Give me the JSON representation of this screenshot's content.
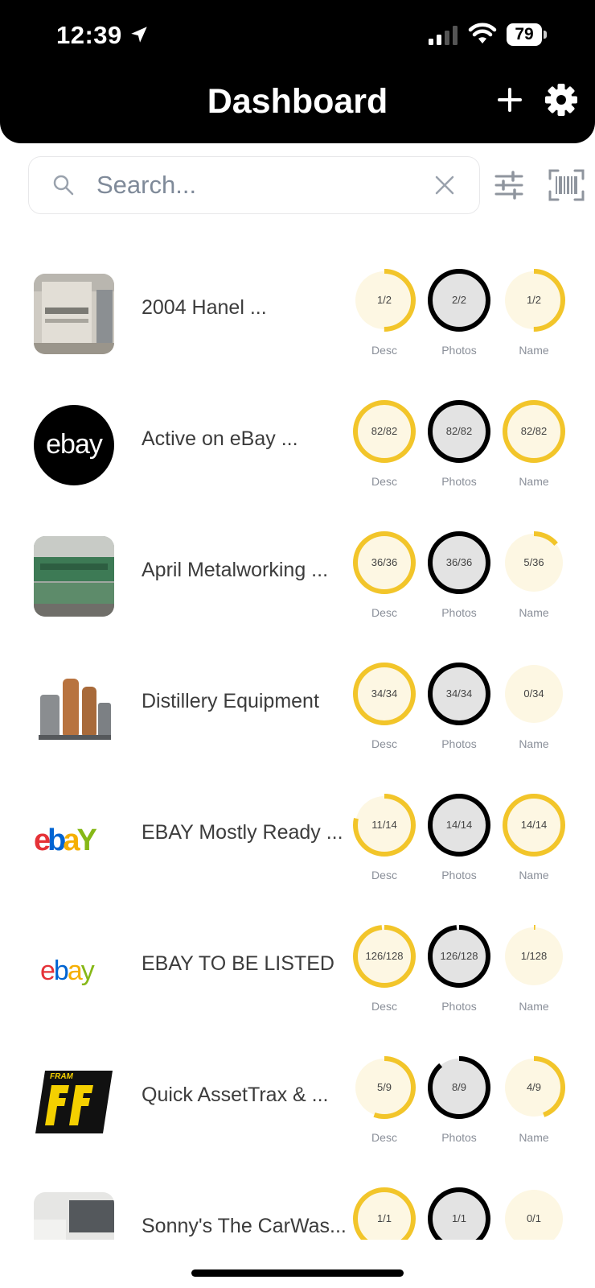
{
  "status_bar": {
    "time": "12:39",
    "battery": "79"
  },
  "header": {
    "title": "Dashboard"
  },
  "search": {
    "placeholder": "Search..."
  },
  "rings": {
    "labels": [
      "Desc",
      "Photos",
      "Name"
    ]
  },
  "items": [
    {
      "name": "2004 Hanel ...",
      "desc": "1/2",
      "photos": "2/2",
      "name_count": "1/2"
    },
    {
      "name": "Active on eBay ...",
      "desc": "82/82",
      "photos": "82/82",
      "name_count": "82/82"
    },
    {
      "name": "April Metalworking ...",
      "desc": "36/36",
      "photos": "36/36",
      "name_count": "5/36"
    },
    {
      "name": "Distillery Equipment",
      "desc": "34/34",
      "photos": "34/34",
      "name_count": "0/34"
    },
    {
      "name": "EBAY Mostly Ready ...",
      "desc": "11/14",
      "photos": "14/14",
      "name_count": "14/14"
    },
    {
      "name": "EBAY TO BE LISTED",
      "desc": "126/128",
      "photos": "126/128",
      "name_count": "1/128"
    },
    {
      "name": "Quick AssetTrax & ...",
      "desc": "5/9",
      "photos": "8/9",
      "name_count": "4/9"
    },
    {
      "name": "Sonny's The CarWas...",
      "desc": "1/1",
      "photos": "1/1",
      "name_count": "0/1"
    }
  ],
  "logos": {
    "ebay": "ebay",
    "fram": "FRAM"
  },
  "colors": {
    "header_bg": "#000000",
    "accent_yellow": "#f2c52a",
    "ring_track_light": "#fdf7e3",
    "ring_track_gray": "#e3e3e3",
    "photos_ring": "#000000"
  }
}
